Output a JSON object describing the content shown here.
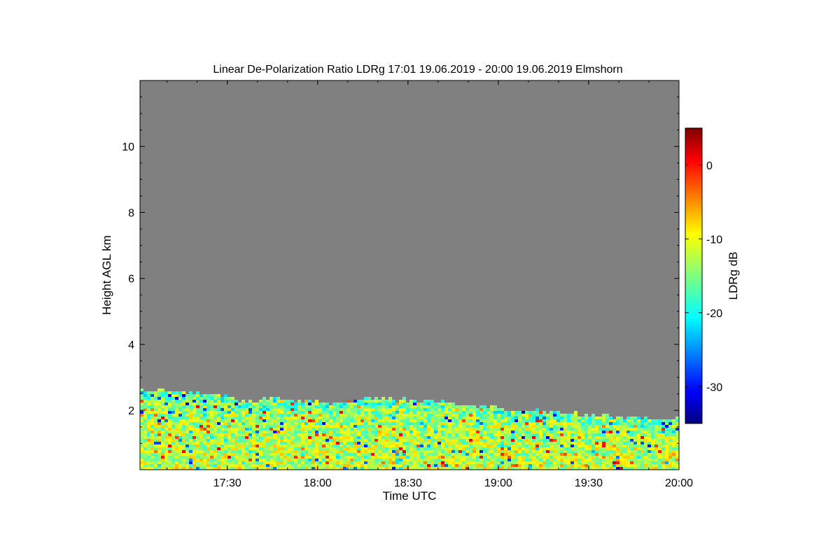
{
  "chart_data": {
    "type": "heatmap",
    "title": "Linear De-Polarization Ratio LDRg   17:01 19.06.2019 - 20:00 19.06.2019 Elmshorn",
    "xlabel": "Time UTC",
    "ylabel": "Height AGL km",
    "x_range": [
      "17:01",
      "20:00"
    ],
    "xticks": [
      "17:30",
      "18:00",
      "18:30",
      "19:00",
      "19:30",
      "20:00"
    ],
    "ylim": [
      0.2,
      12.0
    ],
    "yticks": [
      2,
      4,
      6,
      8,
      10
    ],
    "colorbar": {
      "label": "LDRg dB",
      "range": [
        -35,
        5
      ],
      "ticks": [
        0,
        -10,
        -20,
        -30
      ],
      "colormap": "jet"
    },
    "no_signal_color": "#808080",
    "cloud_top_km": [
      {
        "time": "17:01",
        "height": 2.6
      },
      {
        "time": "17:20",
        "height": 2.5
      },
      {
        "time": "17:30",
        "height": 2.4
      },
      {
        "time": "17:35",
        "height": 2.2
      },
      {
        "time": "17:45",
        "height": 2.35
      },
      {
        "time": "18:00",
        "height": 2.2
      },
      {
        "time": "18:05",
        "height": 2.15
      },
      {
        "time": "18:15",
        "height": 2.3
      },
      {
        "time": "18:25",
        "height": 2.3
      },
      {
        "time": "18:40",
        "height": 2.2
      },
      {
        "time": "19:00",
        "height": 2.0
      },
      {
        "time": "19:20",
        "height": 1.9
      },
      {
        "time": "19:40",
        "height": 1.75
      },
      {
        "time": "20:00",
        "height": 1.7
      }
    ],
    "dominant_ldr_db": -12
  }
}
